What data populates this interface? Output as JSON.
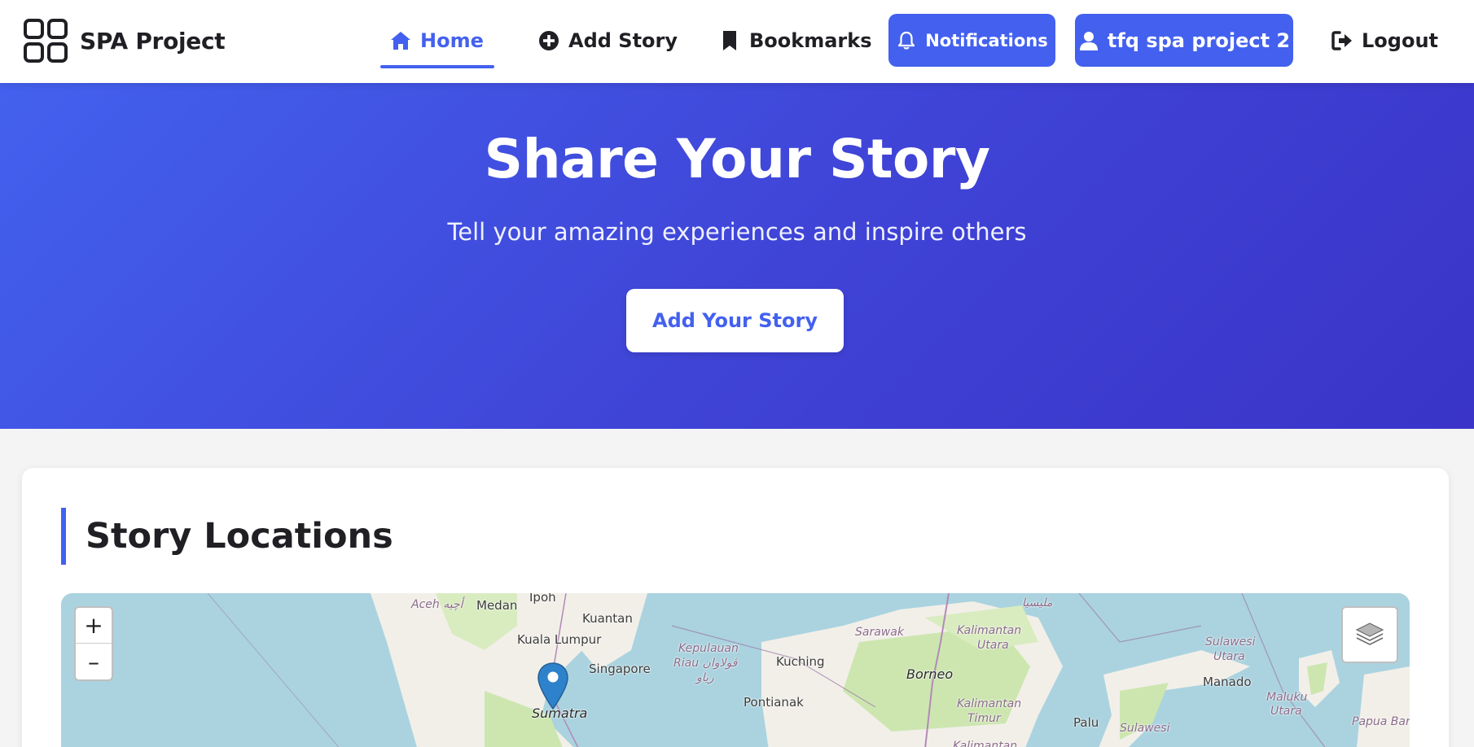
{
  "brand": {
    "name": "SPA Project",
    "icon": "grid-icon"
  },
  "nav": {
    "home": "Home",
    "add_story": "Add Story",
    "bookmarks": "Bookmarks",
    "notifications": "Notifications",
    "user": "tfq spa project 2",
    "logout": "Logout"
  },
  "hero": {
    "title": "Share Your Story",
    "subtitle": "Tell your amazing experiences and inspire others",
    "button": "Add Your Story"
  },
  "locations": {
    "title": "Story Locations",
    "zoom_in": "+",
    "zoom_out": "–",
    "labels": [
      "Aceh أچيه",
      "Medan",
      "Ipoh",
      "Kuantan",
      "Kuala Lumpur",
      "Singapore",
      "Kepulauan",
      "Riau ڤولاوان",
      "رياو",
      "Kuching",
      "Sarawak",
      "Kalimantan",
      "Utara",
      "Borneo",
      "Pontianak",
      "Kalimantan",
      "Timur",
      "Sumatra",
      "Manado",
      "Sulawesi",
      "Utara",
      "Maluku",
      "Utara",
      "Palu",
      "Sulawesi",
      "Papua Bar",
      "Kalimantan",
      "مليسيا"
    ]
  },
  "colors": {
    "accent": "#4361ee",
    "hero_gradient_end": "#3a34c8",
    "map_water": "#aad3df",
    "map_land": "#f2efe9",
    "map_forest": "#cde6b0"
  }
}
